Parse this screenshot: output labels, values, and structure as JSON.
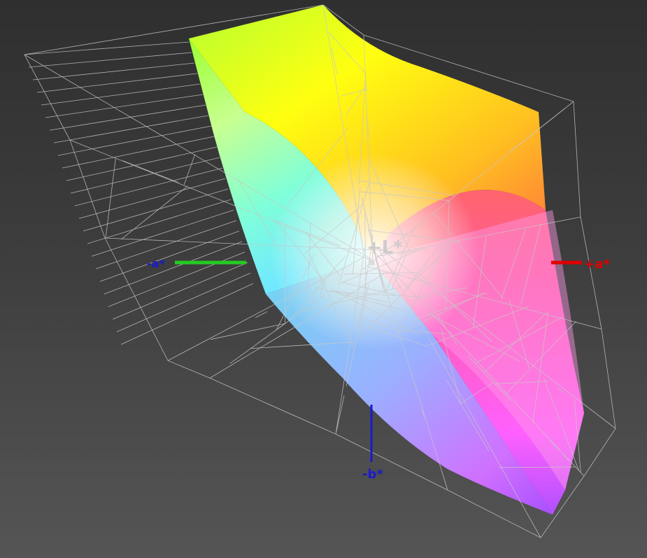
{
  "viewer": {
    "background_top": "#2f2f2f",
    "background_bottom": "#555555",
    "wireframe_color": "#c8c8c8"
  },
  "axes": {
    "plus_a": {
      "label": "+a*",
      "color": "#e00000"
    },
    "minus_a": {
      "label": "-a*",
      "color": "#1a1acc",
      "axis_color": "#22cc22"
    },
    "minus_b": {
      "label": "-b*",
      "color": "#1a1acc"
    },
    "plus_L": {
      "label": "+L*",
      "color": "#c8c8c8"
    }
  },
  "gamut": {
    "solid_colors": [
      "#ffff00",
      "#ff8040",
      "#ff60ff",
      "#b050ff",
      "#60a0ff",
      "#60ffd0",
      "#80ff20",
      "#ffffff"
    ]
  }
}
